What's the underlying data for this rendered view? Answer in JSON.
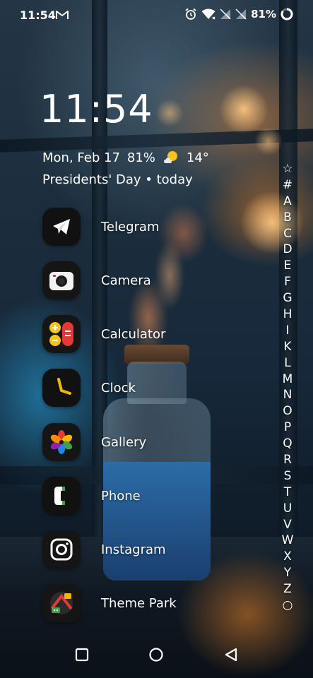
{
  "status_bar": {
    "time": "11:54",
    "battery": "81%",
    "icons": [
      "gmail-icon",
      "alarm-icon",
      "wifi-icon",
      "no-signal-icon",
      "no-signal-icon",
      "battery-ring-icon"
    ]
  },
  "widget": {
    "clock": "11:54",
    "date": "Mon, Feb 17",
    "battery": "81%",
    "weather_icon": "partly-cloudy-icon",
    "temperature": "14°",
    "holiday": "Presidents' Day • today"
  },
  "apps": [
    {
      "label": "Telegram",
      "icon": "telegram-icon"
    },
    {
      "label": "Camera",
      "icon": "camera-icon"
    },
    {
      "label": "Calculator",
      "icon": "calculator-icon"
    },
    {
      "label": "Clock",
      "icon": "clock-icon"
    },
    {
      "label": "Gallery",
      "icon": "gallery-icon"
    },
    {
      "label": "Phone",
      "icon": "phone-icon"
    },
    {
      "label": "Instagram",
      "icon": "instagram-icon"
    },
    {
      "label": "Theme Park",
      "icon": "theme-park-icon"
    }
  ],
  "alphabet_index": [
    "☆",
    "#",
    "A",
    "B",
    "C",
    "D",
    "E",
    "F",
    "G",
    "H",
    "I",
    "K",
    "L",
    "M",
    "N",
    "O",
    "P",
    "Q",
    "R",
    "S",
    "T",
    "U",
    "V",
    "W",
    "X",
    "Y",
    "Z",
    "○"
  ],
  "nav_bar": {
    "buttons": [
      "recents-icon",
      "home-icon",
      "back-icon"
    ]
  },
  "colors": {
    "calculator_yellow": "#f5c518",
    "calculator_red": "#e53935",
    "clock_yellow": "#f5b800",
    "camera_red": "#e53935",
    "theme_park_green": "#43a047"
  }
}
